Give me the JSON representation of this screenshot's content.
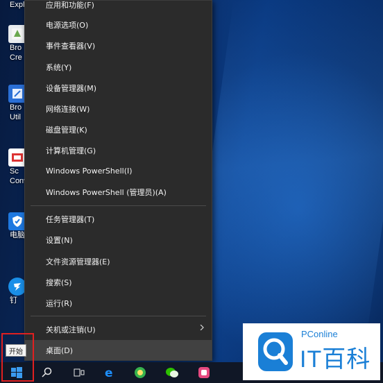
{
  "desktop": {
    "top_label": "Expl",
    "icons": [
      {
        "name": "broadcom-creator",
        "lines": [
          "Bro",
          "Cre"
        ],
        "color": "#6aa84f"
      },
      {
        "name": "broadcom-utility",
        "lines": [
          "Bro",
          "Util"
        ],
        "color": "#2a6fd6"
      },
      {
        "name": "screen-converter",
        "lines": [
          "Sc",
          "Conv"
        ],
        "color": "#d33"
      },
      {
        "name": "pc-manager",
        "lines": [
          "电脑",
          ""
        ],
        "color": "#1e78e0"
      },
      {
        "name": "dingtalk",
        "lines": [
          "钉",
          ""
        ],
        "color": "#1a8fe8"
      }
    ]
  },
  "menu": {
    "items": [
      {
        "label": "应用和功能(F)"
      },
      {
        "label": "电源选项(O)"
      },
      {
        "label": "事件查看器(V)"
      },
      {
        "label": "系统(Y)"
      },
      {
        "label": "设备管理器(M)"
      },
      {
        "label": "网络连接(W)"
      },
      {
        "label": "磁盘管理(K)"
      },
      {
        "label": "计算机管理(G)"
      },
      {
        "label": "Windows PowerShell(I)"
      },
      {
        "label": "Windows PowerShell (管理员)(A)"
      },
      {
        "label": "任务管理器(T)"
      },
      {
        "label": "设置(N)"
      },
      {
        "label": "文件资源管理器(E)"
      },
      {
        "label": "搜索(S)"
      },
      {
        "label": "运行(R)"
      },
      {
        "label": "关机或注销(U)"
      },
      {
        "label": "桌面(D)"
      }
    ]
  },
  "start": {
    "tooltip": "开始"
  },
  "taskbar": {
    "icons": [
      "windows-start-icon",
      "search-icon",
      "task-view-icon",
      "edge-icon",
      "green-app-icon",
      "wechat-icon",
      "pink-app-icon"
    ]
  },
  "watermark": {
    "small": "PConline",
    "big": "IT百科"
  },
  "colors": {
    "menu_bg": "#2b2b2b",
    "highlight": "#e02020",
    "brand": "#1a7fd6"
  }
}
